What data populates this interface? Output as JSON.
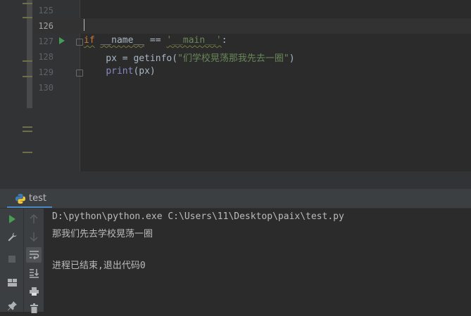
{
  "editor": {
    "line_numbers": [
      "125",
      "126",
      "127",
      "128",
      "129",
      "130"
    ],
    "active_line": "126",
    "code": {
      "l127_kw": "if",
      "l127_name": "__name__",
      "l127_eq": " == ",
      "l127_str": "'__main__'",
      "l127_colon": ":",
      "l128_prefix": "    px = getinfo(",
      "l128_str": "\"们学校晃荡那我先去一圈\"",
      "l128_suffix": ")",
      "l129_fn": "print",
      "l129_rest": "(px)"
    }
  },
  "run_tool_window": {
    "tab_label": "test",
    "console_lines": [
      "D:\\python\\python.exe C:\\Users\\11\\Desktop\\paix\\test.py",
      "那我们先去学校晃荡一圈",
      "",
      "进程已结束,退出代码0"
    ]
  },
  "colors": {
    "keyword": "#cc7832",
    "string": "#6a8759",
    "builtin": "#8888c6",
    "run_green": "#499c54",
    "background": "#2b2b2b"
  }
}
